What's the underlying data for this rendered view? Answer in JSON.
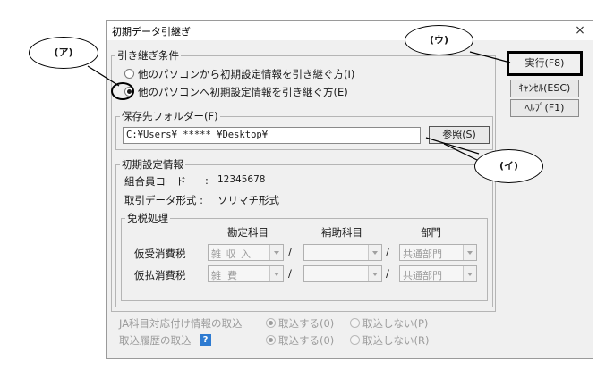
{
  "dialog": {
    "title": "初期データ引継ぎ",
    "close": "×"
  },
  "buttons": {
    "execute": "実行(F8)",
    "cancel": "ｷｬﾝｾﾙ(ESC)",
    "help": "ﾍﾙﾌﾟ(F1)",
    "browse": "参照(S)"
  },
  "conditions": {
    "legend": "引き継ぎ条件",
    "option_from": "他のパソコンから初期設定情報を引き継ぐ方(I)",
    "option_to": "他のパソコンへ初期設定情報を引き継ぐ方(E)",
    "selected": "option_to"
  },
  "folder": {
    "legend": "保存先フォルダー(F)",
    "path": "C:¥Users¥ ***** ¥Desktop¥"
  },
  "settings": {
    "legend": "初期設定情報",
    "member_code_label": "組合員コード",
    "colon": ":",
    "member_code": "12345678",
    "format_label": "取引データ形式 :",
    "format_value": "ソリマチ形式"
  },
  "tax": {
    "legend": "免税処理",
    "col_account": "勘定科目",
    "col_sub": "補助科目",
    "col_dept": "部門",
    "slash": "/",
    "rows": [
      {
        "label": "仮受消費税",
        "account": "雑 収 入",
        "sub": "",
        "dept": "共通部門"
      },
      {
        "label": "仮払消費税",
        "account": "雑  費",
        "sub": "",
        "dept": "共通部門"
      }
    ]
  },
  "ja": {
    "label": "JA科目対応付け情報の取込",
    "yes": "取込する(0)",
    "no": "取込しない(P)"
  },
  "history": {
    "label": "取込履歴の取込",
    "help_icon": "?",
    "yes": "取込する(0)",
    "no": "取込しない(R)"
  },
  "callouts": {
    "a": "(ア)",
    "i": "(イ)",
    "u": "(ウ)"
  },
  "colors": {
    "help_icon": "#2e7bd1",
    "callout_border": "#000000",
    "disabled_text": "#9b9b9b"
  }
}
